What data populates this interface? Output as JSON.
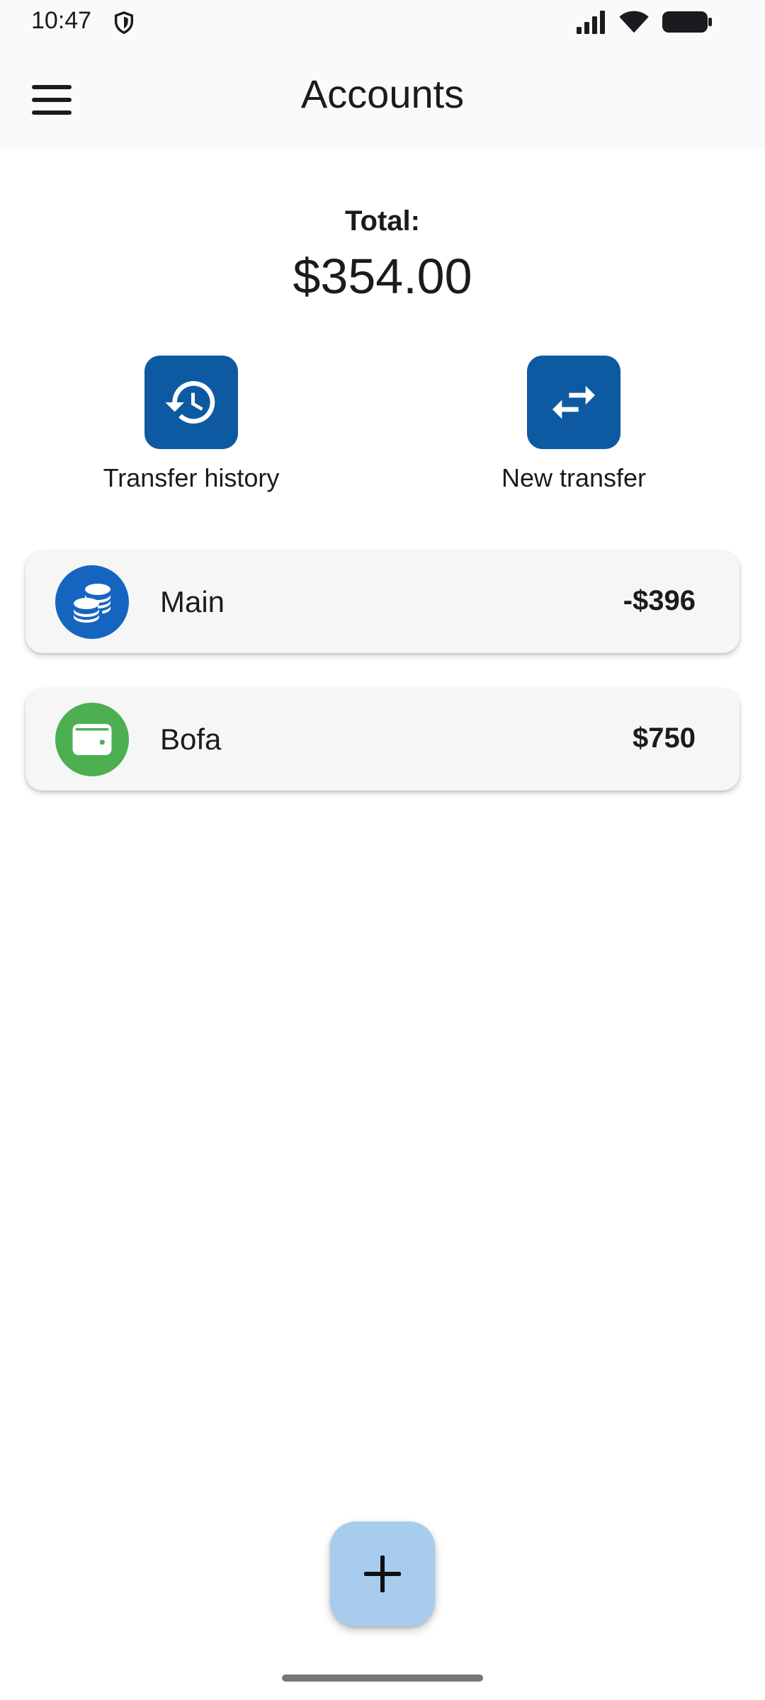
{
  "status_bar": {
    "time": "10:47",
    "icons": [
      "shield-icon",
      "signal-icon",
      "wifi-icon",
      "battery-icon"
    ]
  },
  "app_bar": {
    "title": "Accounts",
    "menu_icon": "menu-icon"
  },
  "summary": {
    "total_label": "Total:",
    "total_value": "$354.00"
  },
  "actions": [
    {
      "label": "Transfer history",
      "icon": "history-icon"
    },
    {
      "label": "New transfer",
      "icon": "swap-arrows-icon"
    }
  ],
  "accounts": [
    {
      "name": "Main",
      "balance": "-$396",
      "icon": "coins-icon",
      "color": "#1565c0"
    },
    {
      "name": "Bofa",
      "balance": "$750",
      "icon": "wallet-icon",
      "color": "#4caf50"
    }
  ],
  "fab": {
    "icon": "plus-icon"
  },
  "colors": {
    "action_blue": "#0d5aa2",
    "fab": "#a8ccee",
    "bar_background": "#fafafa"
  }
}
